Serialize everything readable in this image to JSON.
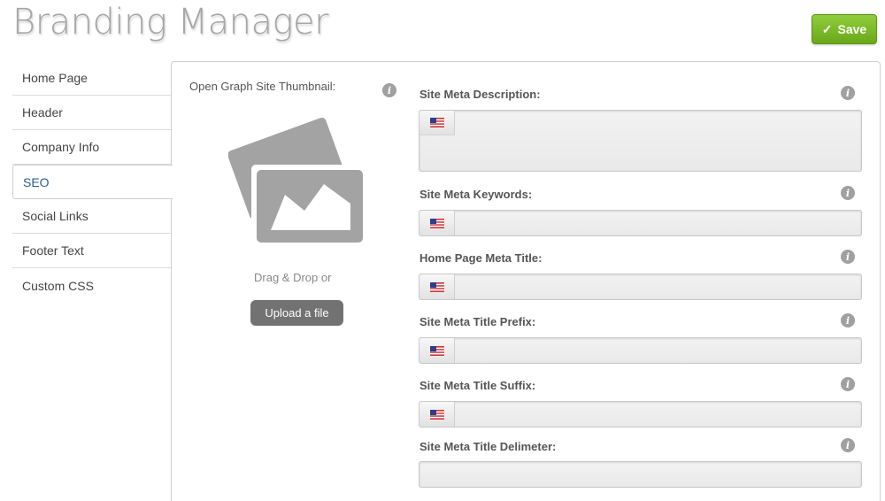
{
  "page": {
    "title": "Branding Manager"
  },
  "toolbar": {
    "save_label": "Save",
    "save_icon": "check-icon",
    "accent": "#7dbb2a"
  },
  "sidebar": {
    "items": [
      {
        "label": "Home Page",
        "active": false
      },
      {
        "label": "Header",
        "active": false
      },
      {
        "label": "Company Info",
        "active": false
      },
      {
        "label": "SEO",
        "active": true
      },
      {
        "label": "Social Links",
        "active": false
      },
      {
        "label": "Footer Text",
        "active": false
      },
      {
        "label": "Custom CSS",
        "active": false
      }
    ],
    "active_color": "#2a5d8a"
  },
  "thumbnail": {
    "label": "Open Graph Site Thumbnail:",
    "drag_text": "Drag & Drop or",
    "upload_label": "Upload a file",
    "icon": "image-placeholder-icon"
  },
  "fields": [
    {
      "label": "Site Meta Description:",
      "value": "",
      "flag": "us-flag-icon"
    },
    {
      "label": "Site Meta Keywords:",
      "value": "",
      "flag": "us-flag-icon"
    },
    {
      "label": "Home Page Meta Title:",
      "value": "",
      "flag": "us-flag-icon"
    },
    {
      "label": "Site Meta Title Prefix:",
      "value": "",
      "flag": "us-flag-icon"
    },
    {
      "label": "Site Meta Title Suffix:",
      "value": "",
      "flag": "us-flag-icon"
    },
    {
      "label": "Site Meta Title Delimeter:",
      "value": ""
    }
  ],
  "info_icon": {
    "glyph": "i",
    "name": "info-icon"
  }
}
